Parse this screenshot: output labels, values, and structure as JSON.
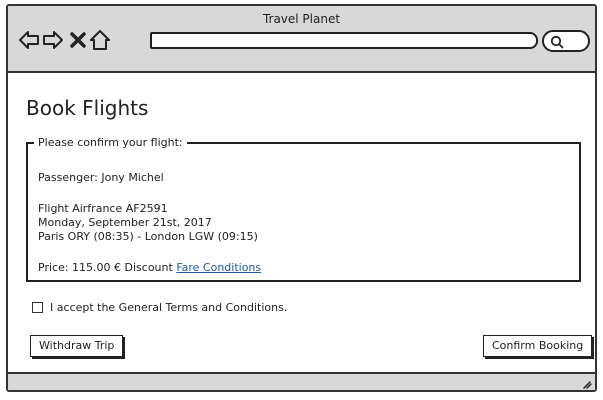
{
  "window": {
    "title": "Travel Planet"
  },
  "toolbar": {
    "back_icon": "arrow-left-icon",
    "forward_icon": "arrow-right-icon",
    "stop_icon": "close-icon",
    "home_icon": "home-icon",
    "url_value": "",
    "search_icon": "search-icon"
  },
  "page": {
    "title": "Book Flights",
    "confirm_box": {
      "legend": "Please confirm your flight:",
      "passenger": "Passenger: Jony Michel",
      "flight": "Flight Airfrance AF2591",
      "date": "Monday, September 21st, 2017",
      "route": "Paris ORY (08:35) - London LGW (09:15)",
      "price": "Price: 115.00 € Discount",
      "conditions_link": "Fare Conditions"
    },
    "accept_terms": {
      "label": "I accept the General Terms and Conditions.",
      "checked": false
    },
    "withdraw_label": "Withdraw Trip",
    "confirm_label": "Confirm Booking"
  },
  "colors": {
    "chrome": "#d8d8d8",
    "link": "#1e5aa8",
    "border": "#222222"
  }
}
